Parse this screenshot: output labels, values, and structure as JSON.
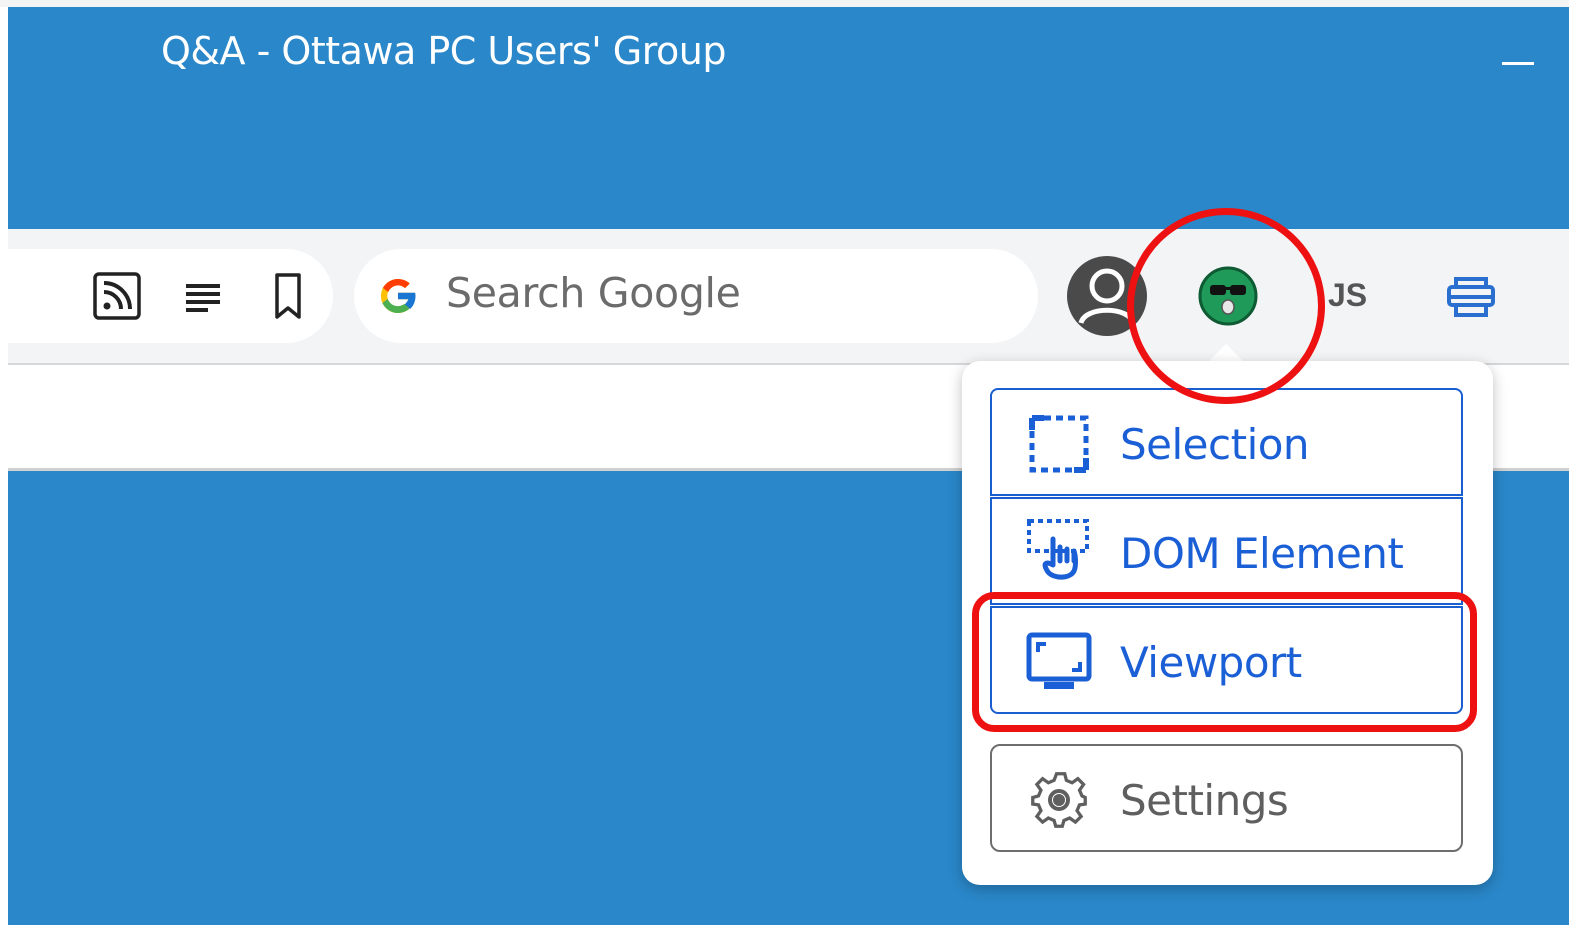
{
  "window": {
    "title": "Q&A - Ottawa PC Users' Group",
    "accent_color": "#2a87c9",
    "minimize_icon": "minimize-icon"
  },
  "toolbar": {
    "buttons": [
      {
        "name": "feed-icon"
      },
      {
        "name": "reader-mode-icon"
      },
      {
        "name": "bookmark-icon"
      }
    ],
    "search": {
      "placeholder": "Search Google",
      "icon": "google-logo-icon"
    },
    "extensions": [
      {
        "name": "profile-avatar-icon"
      },
      {
        "name": "screenshot-extension-icon"
      },
      {
        "name": "js-extension",
        "label": "JS"
      },
      {
        "name": "print-icon"
      }
    ]
  },
  "popup": {
    "items": [
      {
        "label": "Selection",
        "icon": "selection-icon",
        "color": "#1b5fd6"
      },
      {
        "label": "DOM Element",
        "icon": "dom-element-icon",
        "color": "#1b5fd6"
      },
      {
        "label": "Viewport",
        "icon": "viewport-icon",
        "color": "#1b5fd6"
      },
      {
        "label": "Settings",
        "icon": "gear-icon",
        "color": "#5f5f5f"
      }
    ]
  },
  "annotations": {
    "color": "#ee1111",
    "marks": [
      "circle-around-extension-icon",
      "box-around-viewport-item"
    ]
  }
}
